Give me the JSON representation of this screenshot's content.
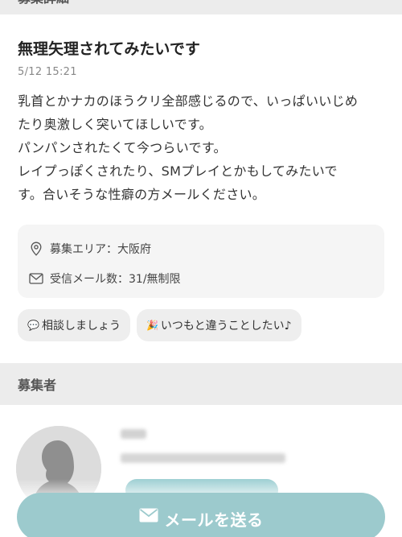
{
  "sections": {
    "details_header": "募集詳細",
    "recruiter_header": "募集者"
  },
  "post": {
    "title": "無理矢理されてみたいです",
    "date": "5/12 15:21",
    "body": "乳首とかナカのほうクリ全部感じるので、いっぱいいじめ\nたり奥激しく突いてほしいです。\nパンパンされたくて今つらいです。\nレイプっぽくされたり、SMプレイとかもしてみたいで\nす。合いそうな性癖の方メールください。"
  },
  "info": {
    "area": "募集エリア：大阪府",
    "mail_count": "受信メール数：31/無制限"
  },
  "tags": [
    {
      "emoji": "💬",
      "label": "相談しましょう"
    },
    {
      "emoji": "🎉",
      "label": "いつもと違うことしたい♪"
    }
  ],
  "actions": {
    "send_mail": "メールを送る"
  },
  "colors": {
    "accent": "#9ccacd",
    "section_bg": "#ececec",
    "info_bg": "#f5f5f5"
  },
  "icons": {
    "area": "location-pin-icon",
    "mail": "envelope-icon",
    "send": "envelope-icon"
  }
}
